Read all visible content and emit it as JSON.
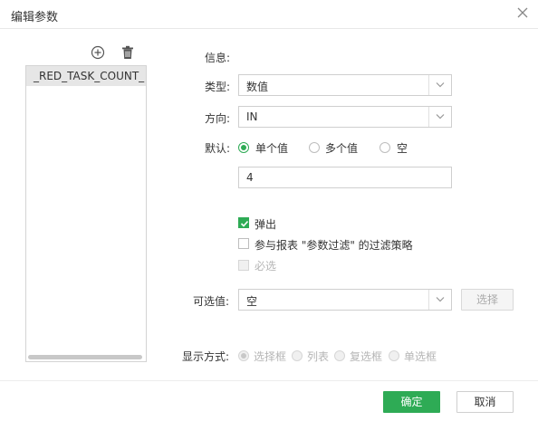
{
  "dialog": {
    "title": "编辑参数"
  },
  "param_list": {
    "items": [
      "_RED_TASK_COUNT_"
    ]
  },
  "form": {
    "info_label": "信息:",
    "type_label": "类型:",
    "type_value": "数值",
    "direction_label": "方向:",
    "direction_value": "IN",
    "default_label": "默认:",
    "default_options": [
      "单个值",
      "多个值",
      "空"
    ],
    "default_selected": "单个值",
    "default_value": "4",
    "popup_label": "弹出",
    "popup_checked": true,
    "participate_label": "参与报表 \"参数过滤\" 的过滤策略",
    "participate_checked": false,
    "required_label": "必选",
    "required_checked": false,
    "optional_label": "可选值:",
    "optional_value": "空",
    "select_button": "选择",
    "display_label": "显示方式:",
    "display_options": [
      "选择框",
      "列表",
      "复选框",
      "单选框"
    ],
    "display_selected": "选择框"
  },
  "footer": {
    "ok": "确定",
    "cancel": "取消"
  },
  "colors": {
    "accent": "#2eab55"
  }
}
